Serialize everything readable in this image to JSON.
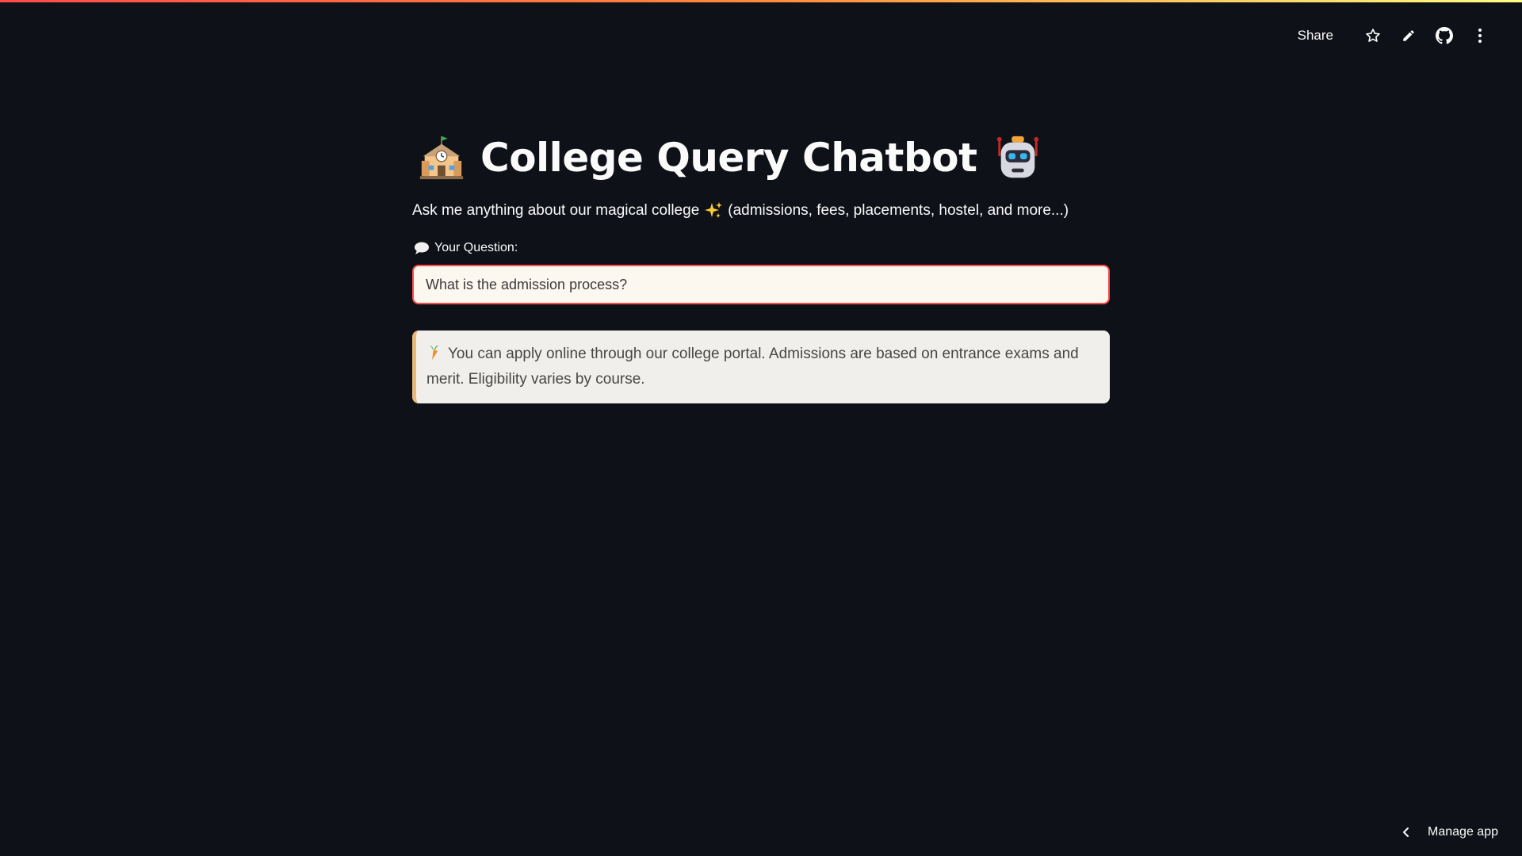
{
  "header": {
    "share_label": "Share",
    "icons": [
      "star-icon",
      "pencil-icon",
      "github-icon",
      "more-vertical-icon"
    ]
  },
  "app": {
    "title": "College Query Chatbot",
    "title_leading_icon": "school-emoji",
    "title_trailing_icon": "robot-emoji",
    "subtitle_prefix": "Ask me anything about our magical college",
    "subtitle_icon": "sparkles-emoji",
    "subtitle_suffix": "(admissions, fees, placements, hostel, and more...)"
  },
  "question": {
    "label": "Your Question:",
    "label_icon": "speech-bubble-emoji",
    "value": "What is the admission process?"
  },
  "answer": {
    "icon": "carrot-emoji",
    "text": "You can apply online through our college portal. Admissions are based on entrance exams and merit. Eligibility varies by course."
  },
  "footer": {
    "manage_label": "Manage app"
  },
  "colors": {
    "background": "#0e1117",
    "accent": "#ff4b4b",
    "input_bg": "#fdf8ef",
    "answer_bg": "#f1efeb",
    "answer_border": "#e8b87a"
  }
}
